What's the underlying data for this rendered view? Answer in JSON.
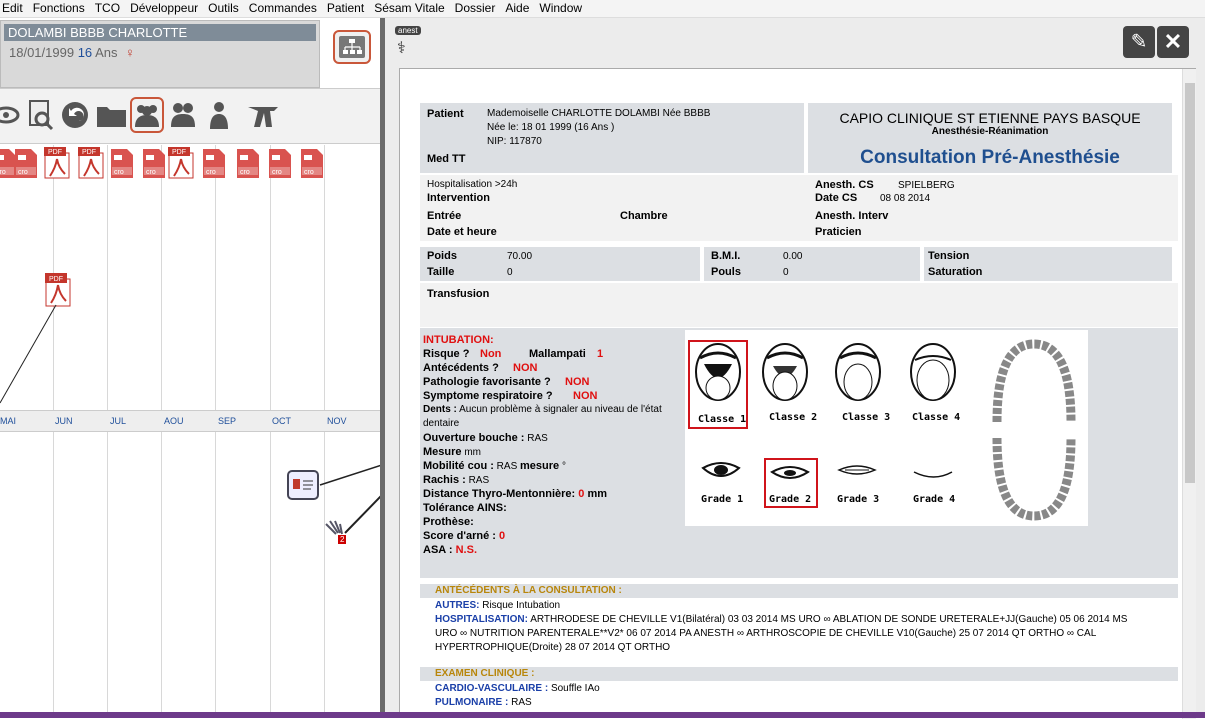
{
  "menu": [
    "Edit",
    "Fonctions",
    "TCO",
    "Développeur",
    "Outils",
    "Commandes",
    "Patient",
    "Sésam Vitale",
    "Dossier",
    "Aide",
    "Window"
  ],
  "patient": {
    "name": "DOLAMBI BBBB CHARLOTTE",
    "dob": "18/01/1999",
    "age": "16",
    "age_unit": "Ans",
    "sex_icon": "female-symbol"
  },
  "timeline": {
    "months": [
      "MAI",
      "JUN",
      "JUL",
      "AOU",
      "SEP",
      "OCT",
      "NOV"
    ],
    "doc_labels": {
      "cro": "cro",
      "pdf": "PDF"
    },
    "badge": "2"
  },
  "icons": {
    "tree": "tree-icon",
    "eye": "eye-icon",
    "search": "search-doc-icon",
    "back": "back-icon",
    "folder": "folder-icon",
    "group": "group-icon",
    "people": "people-icon",
    "person": "person-icon",
    "hat": "hat-icon"
  },
  "viewer": {
    "badge": "anest",
    "edit_icon": "edit-icon",
    "close_icon": "close-icon"
  },
  "doc": {
    "patient_label": "Patient",
    "patient_line1": "Mademoiselle CHARLOTTE DOLAMBI Née BBBB",
    "patient_line2": "Née le: 18 01 1999 (16 Ans )",
    "patient_line3": "NIP: 117870",
    "med": "Med TT",
    "clinic": "CAPIO CLINIQUE ST ETIENNE PAYS BASQUE",
    "service": "Anesthésie-Réanimation",
    "title": "Consultation Pré-Anesthésie",
    "hosp": "Hospitalisation >24h",
    "intervention": "Intervention",
    "entree": "Entrée",
    "chambre": "Chambre",
    "date_heure": "Date et heure",
    "anesth_cs_label": "Anesth. CS",
    "anesth_cs": "SPIELBERG",
    "date_cs_label": "Date CS",
    "date_cs": "08 08 2014",
    "anesth_interv": "Anesth. Interv",
    "praticien": "Praticien",
    "poids_label": "Poids",
    "poids": "70.00",
    "taille_label": "Taille",
    "taille": "0",
    "bmi_label": "B.M.I.",
    "bmi": "0.00",
    "pouls_label": "Pouls",
    "pouls": "0",
    "tension": "Tension",
    "saturation": "Saturation",
    "transfusion": "Transfusion",
    "intub_title": "INTUBATION:",
    "risque_label": "Risque ?",
    "risque": "Non",
    "mallampati_label": "Mallampati",
    "mallampati": "1",
    "atcd_label": "Antécédents ?",
    "atcd": "NON",
    "patho_label": "Pathologie favorisante ?",
    "patho": "NON",
    "sympt_label": "Symptome respiratoire ?",
    "sympt": "NON",
    "dents_label": "Dents :",
    "dents": "Aucun problème à signaler au niveau de l'état",
    "dents2": "dentaire",
    "ouverture_label": "Ouverture bouche :",
    "ouverture": "RAS",
    "mesure_label": "Mesure",
    "mesure": "mm",
    "mobilite_label": "Mobilité cou :",
    "mobilite": "RAS",
    "mesure2": "mesure",
    "deg": "°",
    "rachis_label": "Rachis :",
    "rachis": "RAS",
    "thyro_label": "Distance Thyro-Mentonnière:",
    "thyro": "0",
    "thyro_unit": "mm",
    "ains": "Tolérance AINS:",
    "prothese": "Prothèse:",
    "arne_label": "Score d'arné :",
    "arne": "0",
    "asa_label": "ASA :",
    "asa": "N.S.",
    "classes": [
      "Classe 1",
      "Classe 2",
      "Classe 3",
      "Classe 4"
    ],
    "grades": [
      "Grade 1",
      "Grade 2",
      "Grade 3",
      "Grade 4"
    ],
    "atcd_consult_title": "ANTÉCÉDENTS À LA CONSULTATION :",
    "autres_label": "AUTRES:",
    "autres": "Risque Intubation",
    "hospit_label": "HOSPITALISATION:",
    "hospit1": "ARTHRODESE DE CHEVILLE V1(Bilatéral) 03 03 2014 MS URO ∞ ABLATION DE SONDE URETERALE+JJ(Gauche) 05 06 2014 MS",
    "hospit2": "URO ∞ NUTRITION PARENTERALE**V2* 06 07 2014 PA ANESTH ∞ ARTHROSCOPIE  DE CHEVILLE V10(Gauche) 25 07 2014 QT ORTHO ∞ CAL",
    "hospit3": "HYPERTROPHIQUE(Droite) 28 07 2014 QT ORTHO",
    "examen_title": "EXAMEN CLINIQUE :",
    "cardio_label": "CARDIO-VASCULAIRE :",
    "cardio": "Souffle IAo",
    "pulmo_label": "PULMONAIRE :",
    "pulmo": "RAS"
  }
}
